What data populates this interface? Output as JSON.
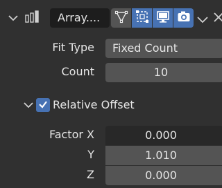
{
  "header": {
    "modifier_name": "Array....",
    "icons": {
      "expand": "chevron-down-icon",
      "modifier_type": "array-modifier-icon",
      "edit_mode": "edit-mode-icon",
      "cage": "on-cage-icon",
      "viewport": "monitor-icon",
      "render": "camera-icon",
      "menu": "chevron-down-icon",
      "close": "close-icon"
    }
  },
  "fit": {
    "label": "Fit Type",
    "value": "Fixed Count"
  },
  "count": {
    "label": "Count",
    "value": "10"
  },
  "relative_offset": {
    "label": "Relative Offset",
    "checked": true
  },
  "factor": {
    "x_label": "Factor X",
    "x_value": "0.000",
    "y_label": "Y",
    "y_value": "1.010",
    "z_label": "Z",
    "z_value": "0.000"
  },
  "colors": {
    "background": "#303030",
    "field": "#545454",
    "field_dark": "#282828",
    "accent": "#4772b3",
    "text": "#e6e6e6"
  }
}
